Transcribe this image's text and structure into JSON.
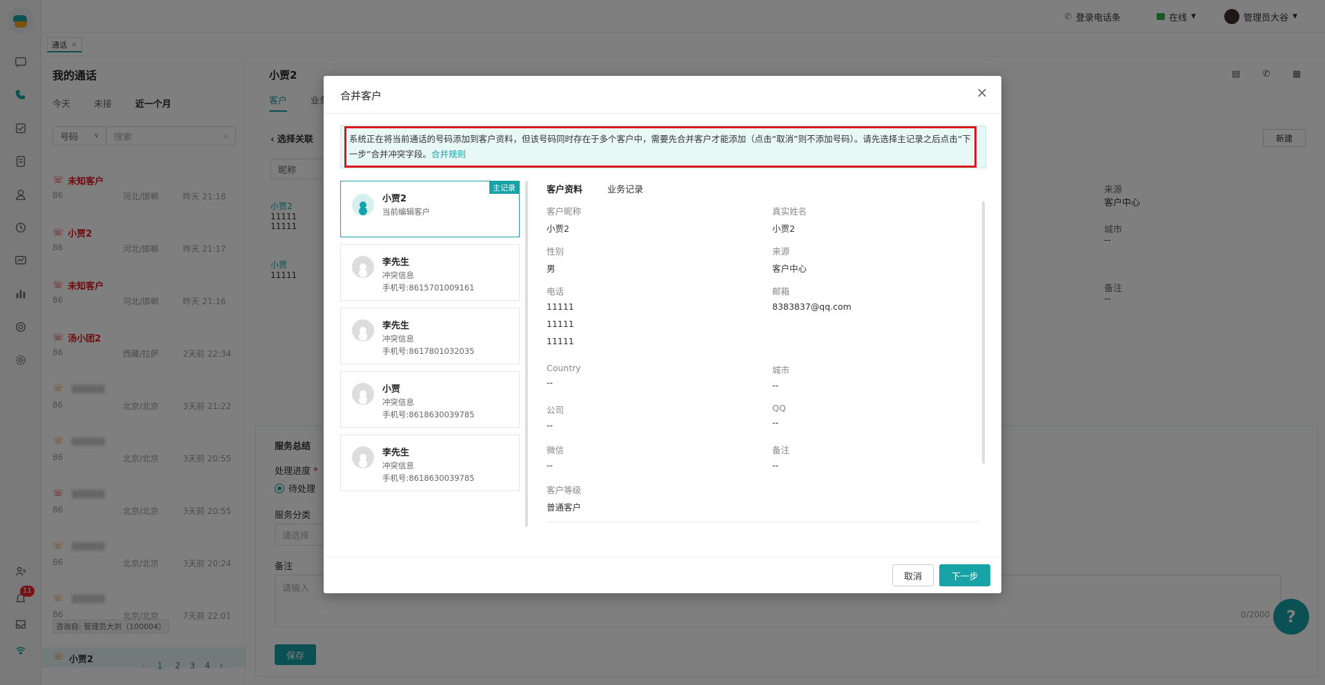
{
  "topbar": {
    "login_label": "登录电话条",
    "status_label": "在线",
    "user_name": "管理员大谷"
  },
  "tabs": [
    {
      "label": "通话"
    }
  ],
  "call_list": {
    "title": "我的通话",
    "filters": [
      "今天",
      "未接",
      "近一个月"
    ],
    "active_filter": "近一个月",
    "select_label": "号码",
    "search_placeholder": "搜索",
    "items": [
      {
        "name": "未知客户",
        "country": "86",
        "region": "河北/邯郸",
        "time": "昨天 21:18",
        "status": "missed"
      },
      {
        "name": "小贾2",
        "country": "86",
        "region": "河北/邯郸",
        "time": "昨天 21:17",
        "status": "missed"
      },
      {
        "name": "未知客户",
        "country": "86",
        "region": "河北/邯郸",
        "time": "昨天 21:16",
        "status": "missed"
      },
      {
        "name": "汤小团2",
        "country": "86",
        "region": "西藏/拉萨",
        "time": "2天前 22:34",
        "status": "missed"
      },
      {
        "name": "",
        "country": "86",
        "region": "北京/北京",
        "time": "3天前 21:22",
        "status": "outgoing"
      },
      {
        "name": "",
        "country": "86",
        "region": "北京/北京",
        "time": "3天前 20:55",
        "status": "outgoing"
      },
      {
        "name": "",
        "country": "86",
        "region": "北京/北京",
        "time": "3天前 20:55",
        "status": "missed"
      },
      {
        "name": "",
        "country": "86",
        "region": "北京/北京",
        "time": "3天前 20:24",
        "status": "outgoing"
      },
      {
        "name": "",
        "country": "86",
        "region": "北京/北京",
        "time": "7天前 22:01",
        "status": "outgoing"
      }
    ],
    "consult_tag": "咨询自: 管理员大刘（100004）",
    "selected_item": "小贾2",
    "pager": [
      "1",
      "2",
      "3",
      "4"
    ],
    "notif_count": "11"
  },
  "main": {
    "customer_name": "小贾2",
    "tabs": [
      "客户",
      "业务"
    ],
    "assoc_title": "选择关联",
    "new_button": "新建",
    "nick_select": "昵称",
    "bg_records": [
      {
        "name": "小贾2",
        "lines": [
          "11111",
          "11111"
        ]
      },
      {
        "name": "小贾",
        "lines": [
          "11111"
        ]
      }
    ],
    "bg_fields": [
      {
        "k": "来源",
        "v": "客户中心"
      },
      {
        "k": "城市",
        "v": "--"
      },
      {
        "k": "备注",
        "v": "--"
      }
    ],
    "service": {
      "title": "服务总结",
      "progress_label": "处理进度",
      "progress_value": "待处理",
      "category_label": "服务分类",
      "category_placeholder": "请选择",
      "note_label": "备注",
      "note_placeholder": "请输入",
      "counter": "0/2000",
      "save_label": "保存"
    }
  },
  "modal": {
    "title": "合并客户",
    "notice": "系统正在将当前通话的号码添加到客户资料，但该号码同时存在于多个客户中，需要先合并客户才能添加（点击“取消”则不添加号码）。请先选择主记录之后点击“下一步”合并冲突字段。",
    "notice_link": "合并规则",
    "records": [
      {
        "name": "小贾2",
        "sub": "当前编辑客户",
        "phone": "",
        "tag": "主记录"
      },
      {
        "name": "李先生",
        "sub": "冲突信息",
        "phone": "手机号:8615701009161",
        "tag": ""
      },
      {
        "name": "李先生",
        "sub": "冲突信息",
        "phone": "手机号:8617801032035",
        "tag": ""
      },
      {
        "name": "小贾",
        "sub": "冲突信息",
        "phone": "手机号:8618630039785",
        "tag": ""
      },
      {
        "name": "李先生",
        "sub": "冲突信息",
        "phone": "手机号:8618630039785",
        "tag": ""
      }
    ],
    "detail_tabs": [
      "客户资料",
      "业务记录"
    ],
    "fields": {
      "nickname": {
        "k": "客户昵称",
        "v": "小贾2"
      },
      "realname": {
        "k": "真实姓名",
        "v": "小贾2"
      },
      "gender": {
        "k": "性别",
        "v": "男"
      },
      "source": {
        "k": "来源",
        "v": "客户中心"
      },
      "phone": {
        "k": "电话",
        "v": [
          "11111",
          "11111",
          "11111"
        ]
      },
      "email": {
        "k": "邮箱",
        "v": "8383837@qq.com"
      },
      "country": {
        "k": "Country",
        "v": "--"
      },
      "city": {
        "k": "城市",
        "v": "--"
      },
      "company": {
        "k": "公司",
        "v": "--"
      },
      "qq": {
        "k": "QQ",
        "v": "--"
      },
      "wechat": {
        "k": "微信",
        "v": "--"
      },
      "remark": {
        "k": "备注",
        "v": "--"
      },
      "level": {
        "k": "客户等级",
        "v": "普通客户"
      }
    },
    "cancel_label": "取消",
    "next_label": "下一步"
  },
  "colors": {
    "accent": "#17a2a7",
    "missed": "#e0121a",
    "outgoing": "#f08c2a",
    "highlight_box": "#e0121a"
  }
}
